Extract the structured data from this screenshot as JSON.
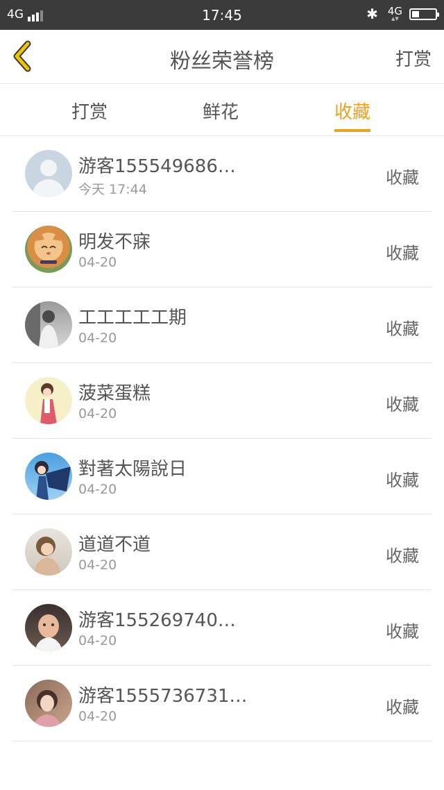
{
  "status_bar": {
    "network": "4G",
    "time": "17:45",
    "network_right": "4G",
    "battery_percent": 30
  },
  "header": {
    "title": "粉丝荣誉榜",
    "action": "打赏",
    "back_icon": "chevron-left-icon",
    "accent": "#f0a01e"
  },
  "tabs": [
    {
      "label": "打赏",
      "active": false
    },
    {
      "label": "鲜花",
      "active": false
    },
    {
      "label": "收藏",
      "active": true
    }
  ],
  "rows": [
    {
      "name": "游客155549686…",
      "date": "今天 17:44",
      "action": "收藏",
      "avatar": "default-user-avatar"
    },
    {
      "name": "明发不寐",
      "date": "04-20",
      "action": "收藏",
      "avatar": "cat-avatar"
    },
    {
      "name": "工工工工工期",
      "date": "04-20",
      "action": "收藏",
      "avatar": "grayscale-photo-avatar"
    },
    {
      "name": "菠菜蛋糕",
      "date": "04-20",
      "action": "收藏",
      "avatar": "anime-girl-avatar"
    },
    {
      "name": "對著太陽說日",
      "date": "04-20",
      "action": "收藏",
      "avatar": "anime-boy-avatar"
    },
    {
      "name": "道道不道",
      "date": "04-20",
      "action": "收藏",
      "avatar": "portrait-avatar"
    },
    {
      "name": "游客155269740…",
      "date": "04-20",
      "action": "收藏",
      "avatar": "child-photo-avatar"
    },
    {
      "name": "游客1555736731…",
      "date": "04-20",
      "action": "收藏",
      "avatar": "selfie-photo-avatar"
    }
  ]
}
